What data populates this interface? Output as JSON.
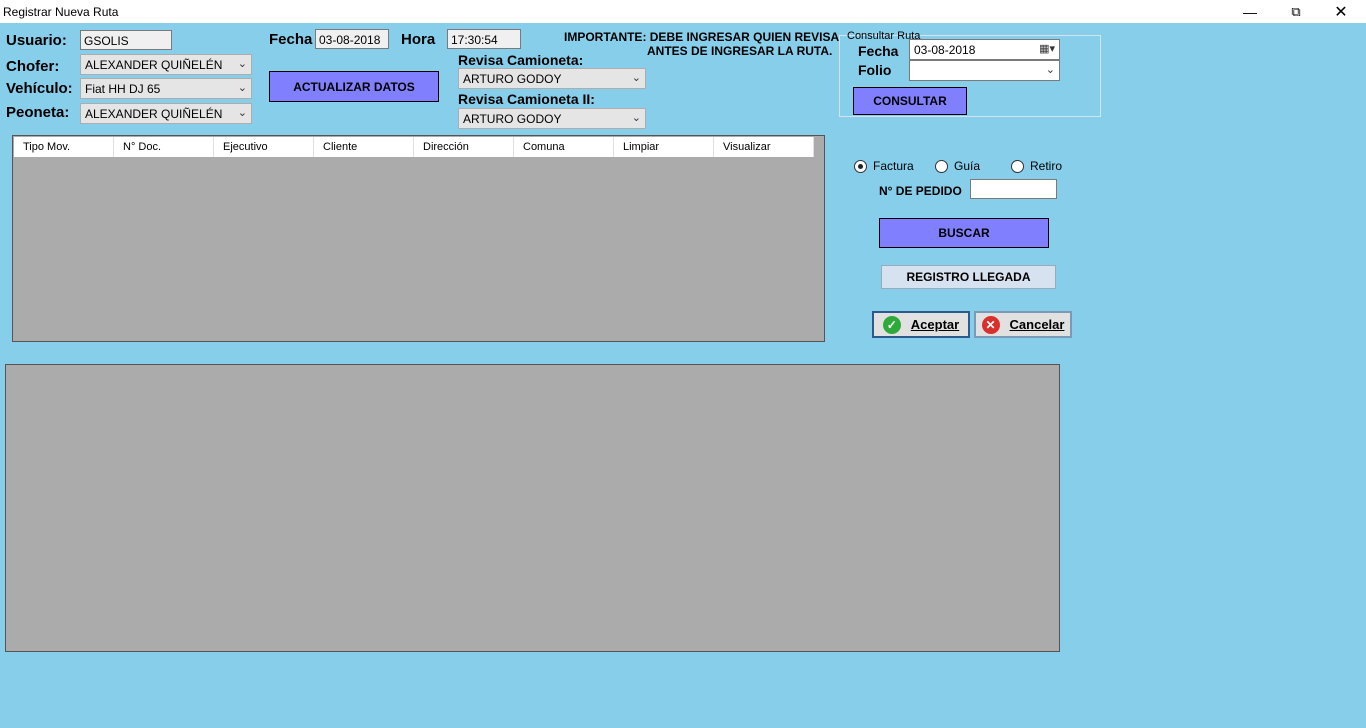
{
  "window": {
    "title": "Registrar Nueva Ruta",
    "icons": [
      "minimize-icon",
      "restore-icon",
      "close-icon"
    ]
  },
  "form": {
    "usuario_label": "Usuario:",
    "usuario_value": "GSOLIS",
    "chofer_label": "Chofer:",
    "chofer_value": "ALEXANDER QUIÑELÉN",
    "vehiculo_label": "Vehículo:",
    "vehiculo_value": "Fiat HH DJ 65",
    "peoneta_label": "Peoneta:",
    "peoneta_value": "ALEXANDER QUIÑELÉN",
    "fecha_label": "Fecha",
    "fecha_value": "03-08-2018",
    "hora_label": "Hora",
    "hora_value": "17:30:54",
    "actualizar_button": "ACTUALIZAR DATOS",
    "important_line1": "IMPORTANTE: DEBE INGRESAR QUIEN REVISA",
    "important_line2": "ANTES DE INGRESAR LA RUTA.",
    "revisa1_label": "Revisa Camioneta:",
    "revisa1_value": "ARTURO GODOY",
    "revisa2_label": "Revisa Camioneta II:",
    "revisa2_value": "ARTURO GODOY"
  },
  "consultar": {
    "group_title": "Consultar Ruta",
    "fecha_label": "Fecha",
    "fecha_value": "03-08-2018",
    "folio_label": "Folio",
    "folio_value": "",
    "button": "CONSULTAR"
  },
  "table": {
    "columns": [
      "Tipo Mov.",
      "N° Doc.",
      "Ejecutivo",
      "Cliente",
      "Dirección",
      "Comuna",
      "Limpiar",
      "Visualizar"
    ]
  },
  "search": {
    "radio_factura": "Factura",
    "radio_guia": "Guía",
    "radio_retiro": "Retiro",
    "selected": "Factura",
    "pedido_label": "N° DE PEDIDO",
    "pedido_value": "",
    "buscar_button": "BUSCAR",
    "registro_button": "REGISTRO LLEGADA",
    "aceptar_button": "Aceptar",
    "cancelar_button": "Cancelar"
  },
  "colors": {
    "background": "#87ceeb",
    "purple_button": "#8080ff",
    "grid": "#ababab"
  }
}
